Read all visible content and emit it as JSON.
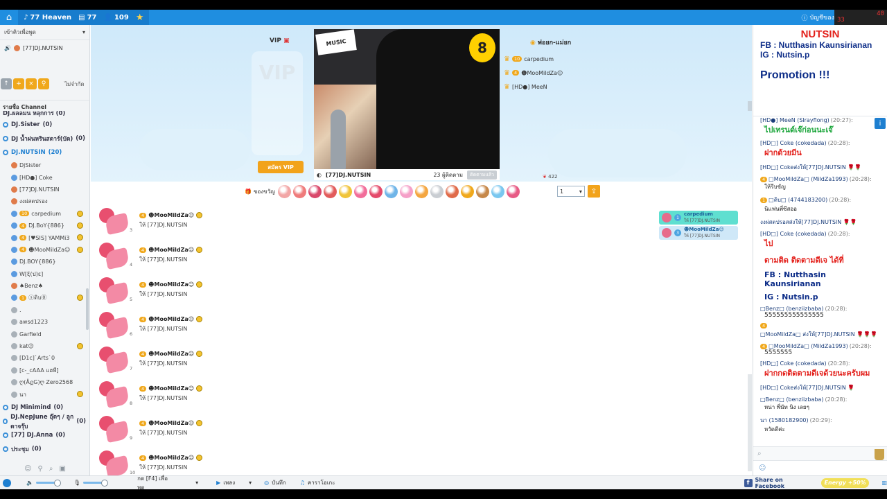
{
  "topbar": {
    "room_name": "77 Heaven",
    "room_id": "77",
    "users_count": "109",
    "account_label": "บัญชีของ",
    "rec_line1": "40",
    "rec_line2": "33",
    "rec_line3": "0:00:01",
    "rec_line4": "5G"
  },
  "left": {
    "header": "เข้าคิวเพื่อพูด",
    "speaker": "[77]DJ.NUTSIN",
    "mode_label": "ไม่จำกัด",
    "channel_title": "รายชื่อ Channel",
    "partial_top": "DJ.ผลลมน หลุกการ (0)",
    "channels_top": [
      {
        "name": "DJ.Sister",
        "count": "(0)"
      },
      {
        "name": "DJ น้ำฝนหรินสดาร์(บัด)",
        "count": "(0)"
      },
      {
        "name": "DJ.NUTSIN",
        "count": "(20)"
      }
    ],
    "users": [
      {
        "name": "DjSister",
        "level": "",
        "emo": false
      },
      {
        "name": "[HD●] Coke",
        "level": "",
        "emo": false
      },
      {
        "name": "[77]DJ.NUTSIN",
        "level": "",
        "emo": false
      },
      {
        "name": "งงผ่สตปรอง",
        "level": "",
        "emo": false
      },
      {
        "name": "carpedium",
        "level": "10",
        "emo": true
      },
      {
        "name": "DJ.BoY{886}",
        "level": "4",
        "emo": true
      },
      {
        "name": "[♥SIS] YAMMi3",
        "level": "4",
        "emo": true
      },
      {
        "name": "☻MooMildZa☺",
        "level": "4",
        "emo": true
      },
      {
        "name": "DJ.BOY{886}",
        "level": "",
        "emo": false
      },
      {
        "name": "W[ξ(ป)ε]",
        "level": "",
        "emo": false
      },
      {
        "name": "♠Benz♠",
        "level": "",
        "emo": false
      },
      {
        "name": "ⓢดิบ⓪",
        "level": "1",
        "emo": true
      },
      {
        "name": ".",
        "level": "",
        "emo": false
      },
      {
        "name": "awsd1223",
        "level": "",
        "emo": false
      },
      {
        "name": "Garfield",
        "level": "",
        "emo": false
      },
      {
        "name": "kat☺",
        "level": "",
        "emo": true
      },
      {
        "name": "[D1c]`Arts`0",
        "level": "",
        "emo": false
      },
      {
        "name": "[c-_cAAA แฮพี]",
        "level": "",
        "emo": false
      },
      {
        "name": "ღ(ÅฏG)ღ Zero2568",
        "level": "",
        "emo": false
      },
      {
        "name": "นา",
        "level": "",
        "emo": true
      }
    ],
    "channels_bottom": [
      {
        "name": "DJ Minimind",
        "count": "(0)"
      },
      {
        "name": "DJ.NepJune อุ๊ดๆ / ลูกดาจรุ๊บ",
        "count": "(0)"
      },
      {
        "name": "[77] DJ.Anna",
        "count": "(0)"
      },
      {
        "name": "ประชุม",
        "count": "(0)"
      }
    ]
  },
  "stage": {
    "vip_label": "VIP",
    "vip_box_text": "VIP",
    "vip_button": "สมัคร VIP",
    "video_logo": "MUSIC",
    "video_badge": "8",
    "dj_name": "[77]DJ.NUTSIN",
    "followers": "23 ผู้ติดตาม",
    "follow_button": "ติดตามแล้ว",
    "parents_title": "พ่อยก-แม่ยก",
    "parents": [
      {
        "name": "carpedium",
        "level": "10"
      },
      {
        "name": "☻MooMildZa☺",
        "level": "4"
      },
      {
        "name": "[HD●] MeeN",
        "level": ""
      }
    ],
    "rose_count": "422"
  },
  "gift_bar": {
    "label": "ของขวัญ",
    "quantity": "1",
    "colors": [
      "#f2a6a6",
      "#ef7b7b",
      "#d9486b",
      "#e25c5c",
      "#f0c43a",
      "#f26d9a",
      "#e44a6b",
      "#6fb5e8",
      "#f5a0c8",
      "#f4a640",
      "#c9cdd2",
      "#e06b4a",
      "#f0a81c",
      "#c6884a",
      "#7ac7ef",
      "#e75b85"
    ]
  },
  "feed": {
    "entries": [
      {
        "sender": "☻MooMildZa☺",
        "level": "4",
        "to": "ให้ [77]DJ.NUTSIN",
        "num": "3"
      },
      {
        "sender": "☻MooMildZa☺",
        "level": "4",
        "to": "ให้ [77]DJ.NUTSIN",
        "num": "4"
      },
      {
        "sender": "☻MooMildZa☺",
        "level": "4",
        "to": "ให้ [77]DJ.NUTSIN",
        "num": "5"
      },
      {
        "sender": "☻MooMildZa☺",
        "level": "4",
        "to": "ให้ [77]DJ.NUTSIN",
        "num": "6"
      },
      {
        "sender": "☻MooMildZa☺",
        "level": "4",
        "to": "ให้ [77]DJ.NUTSIN",
        "num": "7"
      },
      {
        "sender": "☻MooMildZa☺",
        "level": "4",
        "to": "ให้ [77]DJ.NUTSIN",
        "num": "8"
      },
      {
        "sender": "☻MooMildZa☺",
        "level": "4",
        "to": "ให้ [77]DJ.NUTSIN",
        "num": "9"
      },
      {
        "sender": "☻MooMildZa☺",
        "level": "4",
        "to": "ให้ [77]DJ.NUTSIN",
        "num": "10"
      }
    ],
    "top_senders": [
      {
        "rank": "1",
        "name": "carpedium",
        "to": "ให้ [77]DJ.NUTSIN"
      },
      {
        "rank": "3",
        "name": "☻MooMildZa☺",
        "to": "ให้ [77]DJ.NUTSIN"
      }
    ]
  },
  "right": {
    "promo_title": "NUTSIN",
    "promo_fb": "FB : Nutthasin Kaunsirianan",
    "promo_ig": "IG : Nutsin.p",
    "promo_label": "Promotion !!!",
    "messages": [
      {
        "meta": "[HD●] MeeN (Slrayflong)",
        "time": "(20:27):",
        "level": "",
        "body": "ไปเทรนด์เจ๊ก่อนนะเจ๊",
        "style": "green"
      },
      {
        "meta": "[HD□] Coke (cokedada)",
        "time": "(20:28):",
        "level": "",
        "body": "ฝากด้วยมีน",
        "style": "red"
      },
      {
        "meta": "[HD□] Cokeส่งให้[77]DJ.NUTSIN 🌹🌹",
        "time": "",
        "level": "",
        "body": "",
        "style": "sm"
      },
      {
        "meta": "□MooMildZa□ (MildZa1993)",
        "time": "(20:28):",
        "level": "4",
        "body": "ให้รีบขัญ",
        "style": "sm"
      },
      {
        "meta": "□ดิบ□ (4744183200)",
        "time": "(20:28):",
        "level": "1",
        "body": "นิแฟนพี่ซีสออ",
        "style": "sm"
      },
      {
        "meta": "งงผ่สตปรอสส่งให้[77]DJ.NUTSIN 🌹🌹",
        "time": "",
        "level": "",
        "body": "",
        "style": "sm"
      },
      {
        "meta": "[HD□] Coke (cokedada)",
        "time": "(20:28):",
        "level": "",
        "body": "ไป",
        "style": "red"
      },
      {
        "meta": "",
        "time": "",
        "level": "",
        "body": "ตามติด ติดตามดีเจ ได้ที่",
        "style": "red"
      },
      {
        "meta": "",
        "time": "",
        "level": "",
        "body": "FB : Nutthasin Kaunsirianan",
        "style": "navy"
      },
      {
        "meta": "",
        "time": "",
        "level": "",
        "body": "IG : Nutsin.p",
        "style": "navy"
      },
      {
        "meta": "□Benz□ (benziizbaba)",
        "time": "(20:28):",
        "level": "",
        "body": "555555555555555",
        "style": ""
      },
      {
        "meta": "□MooMildZa□ ส่งให้[77]DJ.NUTSIN 🌹🌹🌹",
        "time": "",
        "level": "4",
        "body": "",
        "style": "sm"
      },
      {
        "meta": "□MooMildZa□ (MildZa1993)",
        "time": "(20:28):",
        "level": "4",
        "body": "5555555",
        "style": ""
      },
      {
        "meta": "[HD□] Coke (cokedada)",
        "time": "(20:28):",
        "level": "",
        "body": "ฝากกดติดตามดีเจด้วยนะครับผม",
        "style": "red"
      },
      {
        "meta": "[HD□] Cokeส่งให้[77]DJ.NUTSIN 🌹",
        "time": "",
        "level": "",
        "body": "",
        "style": "sm"
      },
      {
        "meta": "□Benz□ (benziizbaba)",
        "time": "(20:28):",
        "level": "",
        "body": "หน่า พี่นัท นิง เลยๆ",
        "style": "sm"
      },
      {
        "meta": "นา (1580182900)",
        "time": "(20:29):",
        "level": "",
        "body": "หวัดดีค่ะ",
        "style": "sm"
      }
    ]
  },
  "bottom": {
    "talk_label": "กด [F4] เพื่อพูด",
    "music_label": "เพลง",
    "record_label": "บันทึก",
    "karaoke_label": "คาราโอเกะ",
    "share_label": "Share on Facebook",
    "energy_label": "Energy +50%"
  }
}
